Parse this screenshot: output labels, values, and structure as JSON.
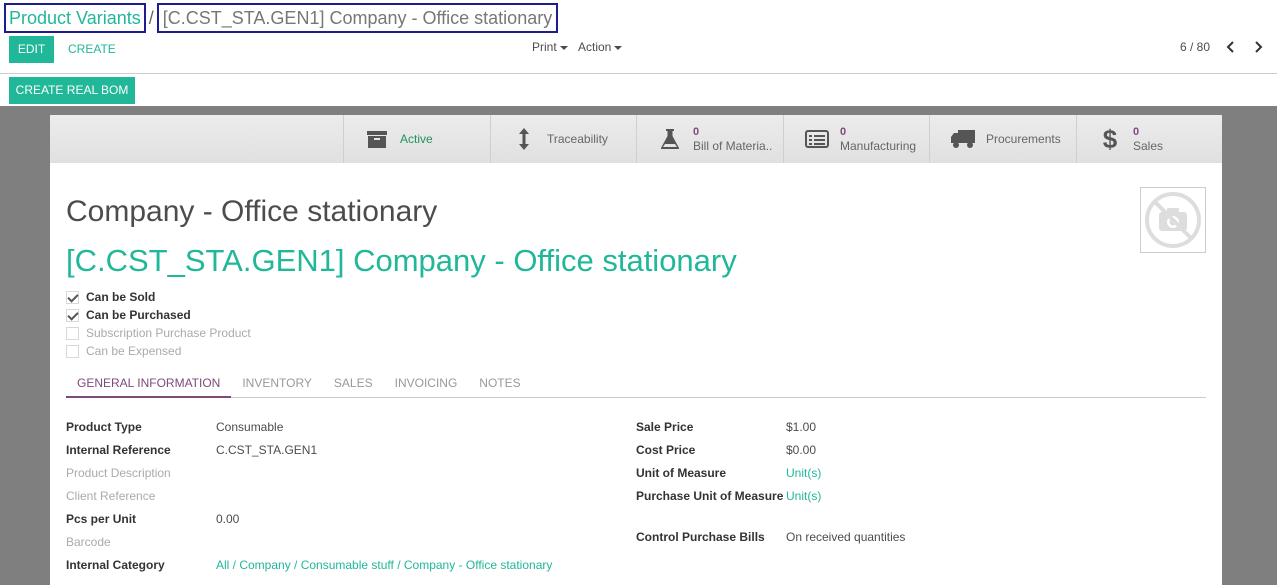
{
  "breadcrumb": {
    "parent": "Product Variants",
    "separator": "/",
    "current": "[C.CST_STA.GEN1] Company - Office stationary"
  },
  "toolbar": {
    "edit_label": "EDIT",
    "create_label": "CREATE",
    "print_label": "Print",
    "action_label": "Action",
    "pager": "6 / 80",
    "create_bom_label": "CREATE REAL BOM"
  },
  "stat_buttons": [
    {
      "label": "Active",
      "icon": "archive-icon"
    },
    {
      "label": "Traceability",
      "icon": "arrows-vertical-icon"
    },
    {
      "count": "0",
      "label": "Bill of Materia..",
      "icon": "flask-icon"
    },
    {
      "count": "0",
      "label": "Manufacturing",
      "icon": "list-icon"
    },
    {
      "label": "Procurements",
      "icon": "truck-icon"
    },
    {
      "count": "0",
      "label": "Sales",
      "icon": "dollar-icon"
    }
  ],
  "product": {
    "name": "Company - Office stationary",
    "variant_name": "[C.CST_STA.GEN1] Company - Office stationary",
    "image_icon": "camera-off-icon"
  },
  "checkboxes": [
    {
      "label": "Can be Sold",
      "checked": true
    },
    {
      "label": "Can be Purchased",
      "checked": true
    },
    {
      "label": "Subscription Purchase Product",
      "checked": false
    },
    {
      "label": "Can be Expensed",
      "checked": false
    }
  ],
  "tabs": [
    "GENERAL INFORMATION",
    "INVENTORY",
    "SALES",
    "INVOICING",
    "NOTES"
  ],
  "general_left": [
    {
      "label": "Product Type",
      "value": "Consumable"
    },
    {
      "label": "Internal Reference",
      "value": "C.CST_STA.GEN1"
    },
    {
      "label": "Product Description",
      "value": ""
    },
    {
      "label": "Client Reference",
      "value": ""
    },
    {
      "label": "Pcs per Unit",
      "value": "0.00"
    },
    {
      "label": "Barcode",
      "value": ""
    },
    {
      "label": "Internal Category",
      "value": "All / Company / Consumable stuff / Company - Office stationary"
    }
  ],
  "general_right": [
    {
      "label": "Sale Price",
      "value": "$1.00"
    },
    {
      "label": "Cost Price",
      "value": "$0.00"
    },
    {
      "label": "Unit of Measure",
      "value": "Unit(s)"
    },
    {
      "label": "Purchase Unit of Measure",
      "value": "Unit(s)"
    },
    {
      "label": "Control Purchase Bills",
      "value": "On received quantities"
    }
  ],
  "colors": {
    "primary": "#21b799",
    "accent_purple": "#7c4a7b",
    "highlight_border": "#1d1d8f"
  }
}
